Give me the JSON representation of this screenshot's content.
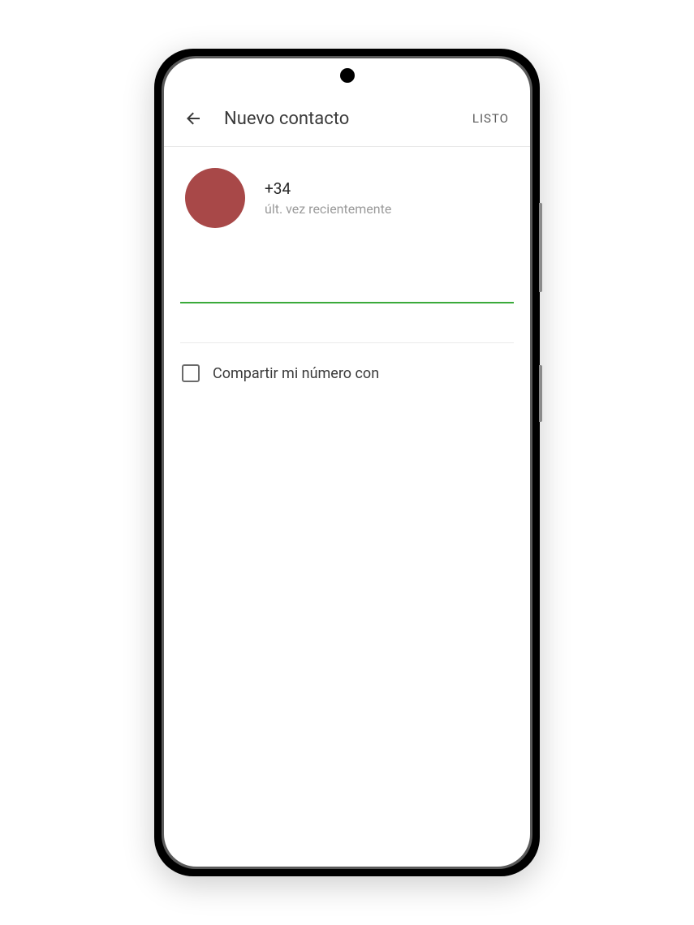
{
  "header": {
    "title": "Nuevo contacto",
    "done_label": "LISTO"
  },
  "contact": {
    "phone": "+34",
    "status": "últ. vez recientemente",
    "avatar_color": "#a84848"
  },
  "input": {
    "name_value": ""
  },
  "share": {
    "label": "Compartir mi número con",
    "checked": false
  }
}
